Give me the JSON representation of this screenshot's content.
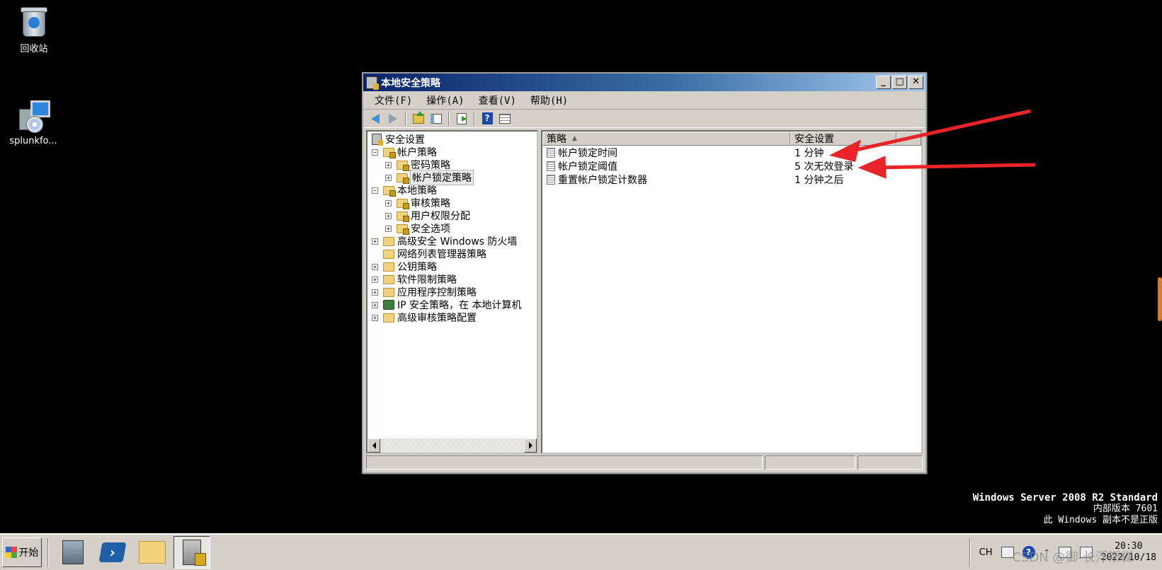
{
  "desktop": {
    "icons": [
      {
        "label": "回收站",
        "icon": "recycle-bin-icon"
      },
      {
        "label": "splunkfo...",
        "icon": "setup-package-icon"
      }
    ]
  },
  "window": {
    "title": "本地安全策略",
    "controls": {
      "minimize": "_",
      "maximize": "□",
      "close": "✕"
    },
    "menu": {
      "file": "文件(F)",
      "action": "操作(A)",
      "view": "查看(V)",
      "help": "帮助(H)"
    },
    "toolbar": [
      "back-icon",
      "forward-icon",
      "up-folder-icon",
      "show-hide-tree-icon",
      "export-list-icon",
      "help-icon",
      "properties-icon"
    ],
    "tree": {
      "root": "安全设置",
      "items": [
        {
          "label": "帐户策略",
          "expanded": true,
          "level": 1
        },
        {
          "label": "密码策略",
          "level": 2
        },
        {
          "label": "帐户锁定策略",
          "level": 2,
          "selected": true
        },
        {
          "label": "本地策略",
          "expanded": true,
          "level": 1
        },
        {
          "label": "审核策略",
          "level": 2
        },
        {
          "label": "用户权限分配",
          "level": 2
        },
        {
          "label": "安全选项",
          "level": 2
        },
        {
          "label": "高级安全 Windows 防火墙",
          "level": 1
        },
        {
          "label": "网络列表管理器策略",
          "level": 1
        },
        {
          "label": "公钥策略",
          "level": 1
        },
        {
          "label": "软件限制策略",
          "level": 1
        },
        {
          "label": "应用程序控制策略",
          "level": 1
        },
        {
          "label": "IP 安全策略，在 本地计算机",
          "level": 1
        },
        {
          "label": "高级审核策略配置",
          "level": 1
        }
      ]
    },
    "list": {
      "columns": [
        "策略",
        "安全设置"
      ],
      "rows": [
        {
          "policy": "帐户锁定时间",
          "setting": "1 分钟"
        },
        {
          "policy": "帐户锁定阈值",
          "setting": "5 次无效登录"
        },
        {
          "policy": "重置帐户锁定计数器",
          "setting": "1 分钟之后"
        }
      ]
    }
  },
  "os_info": {
    "line1": "Windows Server 2008 R2 Standard",
    "line2": "内部版本 7601",
    "line3": "此 Windows 副本不是正版"
  },
  "taskbar": {
    "start_label": "开始",
    "apps": [
      "server-manager-icon",
      "powershell-icon",
      "explorer-folder-icon",
      "local-security-policy-icon"
    ],
    "tray": {
      "lang": "CH",
      "time": "20:30",
      "date": "2022/10/18"
    },
    "watermark": "CSDN @御-长浮斯梯"
  },
  "colors": {
    "annotation_arrow": "#e8242a",
    "titlebar_start": "#0a246a",
    "titlebar_end": "#a6caf0"
  }
}
